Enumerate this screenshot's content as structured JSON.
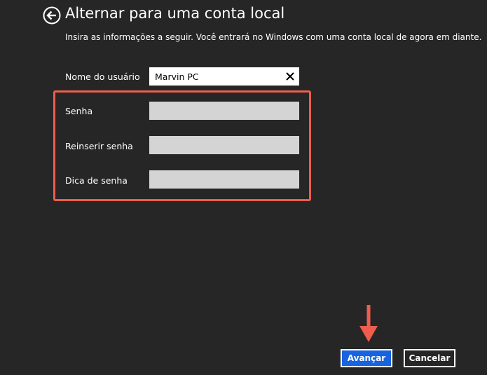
{
  "page": {
    "title": "Alternar para uma conta local",
    "subtitle": "Insira as informações a seguir. Você entrará no Windows com uma conta local de agora em diante.",
    "back_icon": "back-arrow-icon"
  },
  "form": {
    "username_label": "Nome do usuário",
    "username_value": "Marvin PC",
    "clear_icon": "close-icon",
    "password_label": "Senha",
    "password_value": "",
    "reenter_password_label": "Reinserir senha",
    "reenter_password_value": "",
    "password_hint_label": "Dica de senha",
    "password_hint_value": ""
  },
  "buttons": {
    "next_label": "Avançar",
    "cancel_label": "Cancelar"
  },
  "colors": {
    "background": "#262626",
    "accent": "#1763e0",
    "annotation": "#ee5d4d",
    "disabled_field": "#d4d4d4"
  }
}
